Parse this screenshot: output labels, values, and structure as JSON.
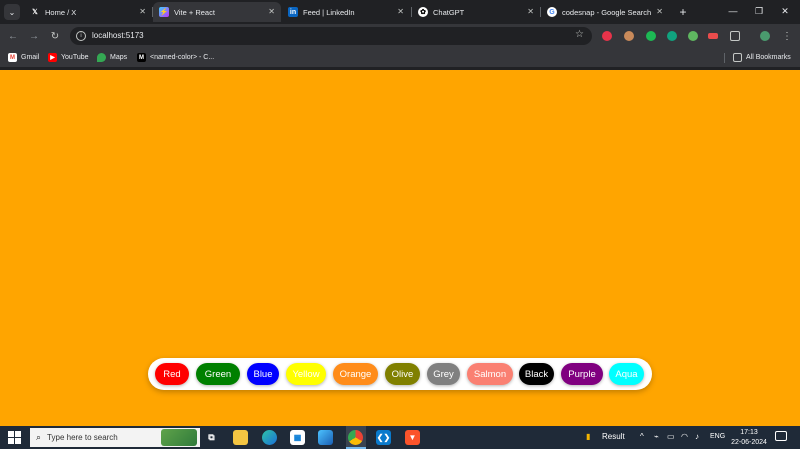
{
  "browser": {
    "tabs": [
      {
        "title": "Home / X",
        "favicon": "x-logo-icon",
        "active": false
      },
      {
        "title": "Vite + React",
        "favicon": "vite-logo-icon",
        "active": true
      },
      {
        "title": "Feed | LinkedIn",
        "favicon": "linkedin-logo-icon",
        "active": false
      },
      {
        "title": "ChatGPT",
        "favicon": "chatgpt-logo-icon",
        "active": false
      },
      {
        "title": "codesnap - Google Search",
        "favicon": "google-logo-icon",
        "active": false
      }
    ],
    "address": "localhost:5173",
    "bookmarks": [
      {
        "label": "Gmail",
        "icon": "gmail-icon"
      },
      {
        "label": "YouTube",
        "icon": "youtube-icon"
      },
      {
        "label": "Maps",
        "icon": "maps-icon"
      },
      {
        "label": "<named-color> - C...",
        "icon": "mdn-icon"
      }
    ],
    "all_bookmarks": "All Bookmarks"
  },
  "page": {
    "background": "#ffa500",
    "buttons": [
      {
        "label": "Red",
        "bg": "#ff0000",
        "fg": "#ffffff"
      },
      {
        "label": "Green",
        "bg": "#008000",
        "fg": "#ffffff"
      },
      {
        "label": "Blue",
        "bg": "#0000ff",
        "fg": "#ffffff"
      },
      {
        "label": "Yellow",
        "bg": "#ffff00",
        "fg": "#ffffff"
      },
      {
        "label": "Orange",
        "bg": "#ff8c1a",
        "fg": "#ffffff"
      },
      {
        "label": "Olive",
        "bg": "#808000",
        "fg": "#ffffff"
      },
      {
        "label": "Grey",
        "bg": "#808080",
        "fg": "#ffffff"
      },
      {
        "label": "Salmon",
        "bg": "#fa8072",
        "fg": "#ffffff"
      },
      {
        "label": "Black",
        "bg": "#000000",
        "fg": "#ffffff"
      },
      {
        "label": "Purple",
        "bg": "#800080",
        "fg": "#ffffff"
      },
      {
        "label": "Aqua",
        "bg": "#00ffff",
        "fg": "#ffffff"
      }
    ]
  },
  "taskbar": {
    "search_placeholder": "Type here to search",
    "widget_label": "Result",
    "language": "ENG",
    "time": "17:13",
    "date": "22-06-2024"
  }
}
